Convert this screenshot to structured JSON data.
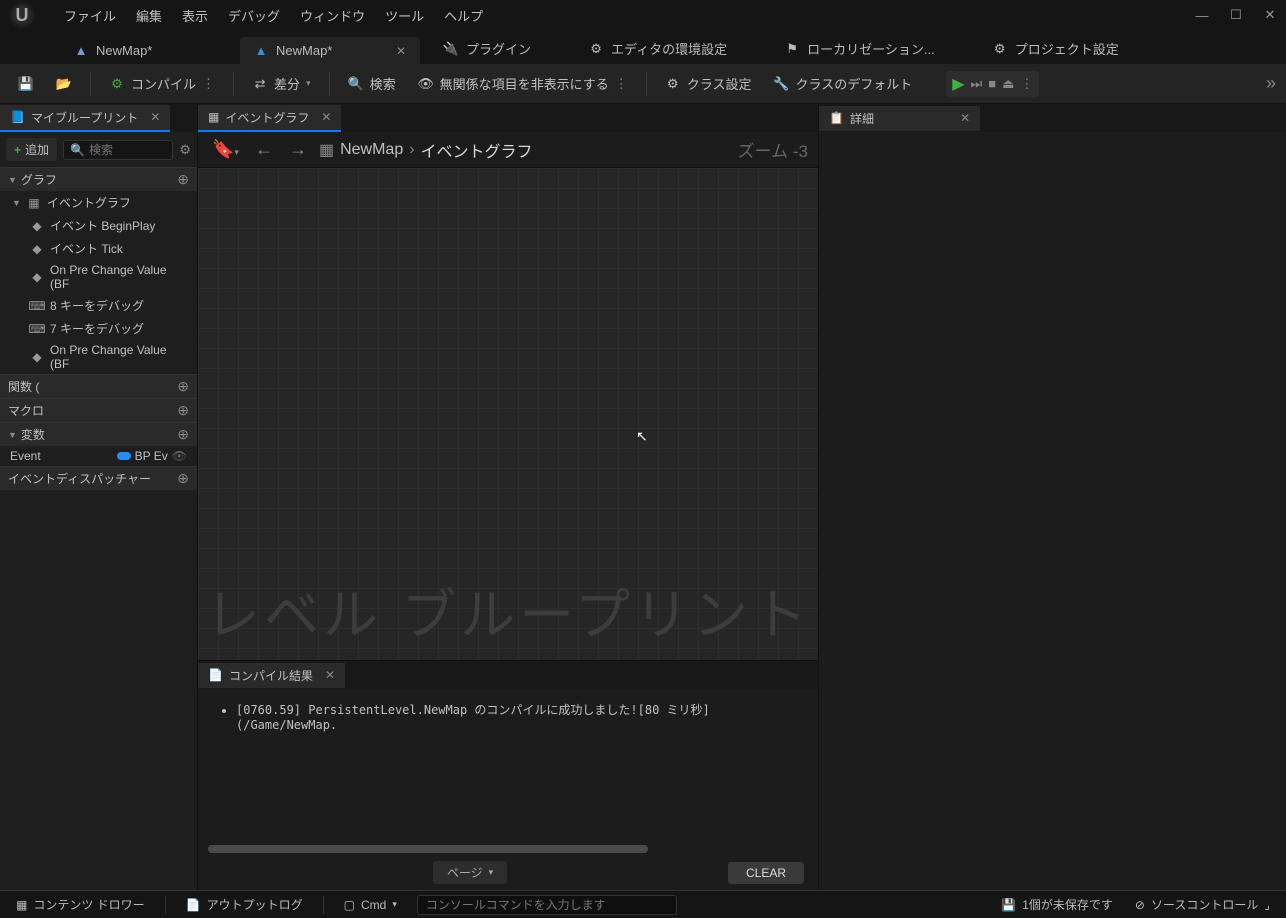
{
  "menus": [
    "ファイル",
    "編集",
    "表示",
    "デバッグ",
    "ウィンドウ",
    "ツール",
    "ヘルプ"
  ],
  "top_tabs": {
    "file1": "NewMap*",
    "file2": "NewMap*",
    "plugins": "プラグイン",
    "editor_prefs": "エディタの環境設定",
    "localization": "ローカリゼーション...",
    "project_settings": "プロジェクト設定"
  },
  "toolbar": {
    "compile": "コンパイル",
    "diff": "差分",
    "search": "検索",
    "hide_unrelated": "無関係な項目を非表示にする",
    "class_settings": "クラス設定",
    "class_defaults": "クラスのデフォルト"
  },
  "left_panel": {
    "tab": "マイブループリント",
    "add": "追加",
    "search_placeholder": "検索",
    "graph": "グラフ",
    "event_graph": "イベントグラフ",
    "items": [
      "イベント BeginPlay",
      "イベント Tick",
      "On Pre Change Value (BF",
      "8 キーをデバッグ",
      "7 キーをデバッグ",
      "On Pre Change Value (BF"
    ],
    "functions": "関数 (",
    "macros": "マクロ",
    "variables": "変数",
    "var_name": "Event",
    "var_type": "BP Ev",
    "dispatchers": "イベントディスパッチャー"
  },
  "center": {
    "tab": "イベントグラフ",
    "breadcrumb_root": "NewMap",
    "breadcrumb_current": "イベントグラフ",
    "zoom": "ズーム -3",
    "watermark": "レベル ブループリント"
  },
  "compile": {
    "tab": "コンパイル結果",
    "message": "[0760.59] PersistentLevel.NewMap のコンパイルに成功しました![80 ミリ秒] (/Game/NewMap.",
    "page": "ページ",
    "clear": "CLEAR"
  },
  "details": {
    "tab": "詳細"
  },
  "status": {
    "content_drawer": "コンテンツ ドロワー",
    "output_log": "アウトプットログ",
    "cmd": "Cmd",
    "cmd_placeholder": "コンソールコマンドを入力します",
    "unsaved": "1個が未保存です",
    "source_control": "ソースコントロール"
  }
}
